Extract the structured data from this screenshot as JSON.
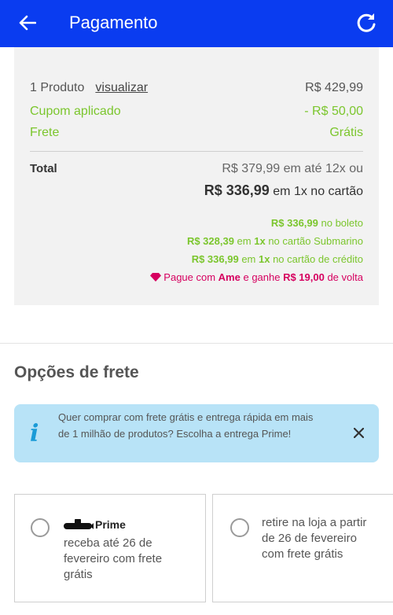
{
  "header": {
    "title": "Pagamento",
    "color": "#0a3cf0"
  },
  "summary": {
    "products_label": "1 Produto",
    "view_link": "visualizar",
    "products_price": "R$ 429,99",
    "coupon_label": "Cupom aplicado",
    "coupon_value": "- R$ 50,00",
    "shipping_label": "Frete",
    "shipping_value": "Grátis",
    "total_label": "Total",
    "installment_text": "R$ 379,99 em até 12x ou",
    "card_price": "R$ 336,99",
    "card_suffix": " em 1x no cartão",
    "options": {
      "boleto_price": "R$ 336,99",
      "boleto_text": " no boleto",
      "submarino_price": "R$ 328,39",
      "submarino_em": " em ",
      "submarino_1x": "1x",
      "submarino_text": " no cartão Submarino",
      "credito_price": "R$ 336,99",
      "credito_em": " em ",
      "credito_1x": "1x",
      "credito_text": " no cartão de crédito",
      "ame_prefix": "Pague com ",
      "ame_brand": "Ame",
      "ame_middle": " e ganhe ",
      "ame_value": "R$ 19,00",
      "ame_suffix": " de volta"
    },
    "accent_green": "#7bc62d",
    "accent_pink": "#d6005f"
  },
  "shipping": {
    "section_title": "Opções de frete",
    "info_text": "Quer comprar com frete grátis e entrega rápida em mais de 1 milhão de produtos? Escolha a entrega Prime!",
    "options": [
      {
        "brand": "Prime",
        "desc_line1": "receba até 26 de",
        "desc_line2": "fevereiro com frete",
        "desc_line3": "grátis"
      },
      {
        "desc_line1": "retire na loja a partir",
        "desc_line2": "de 26 de fevereiro",
        "desc_line3": "com frete grátis"
      }
    ]
  }
}
